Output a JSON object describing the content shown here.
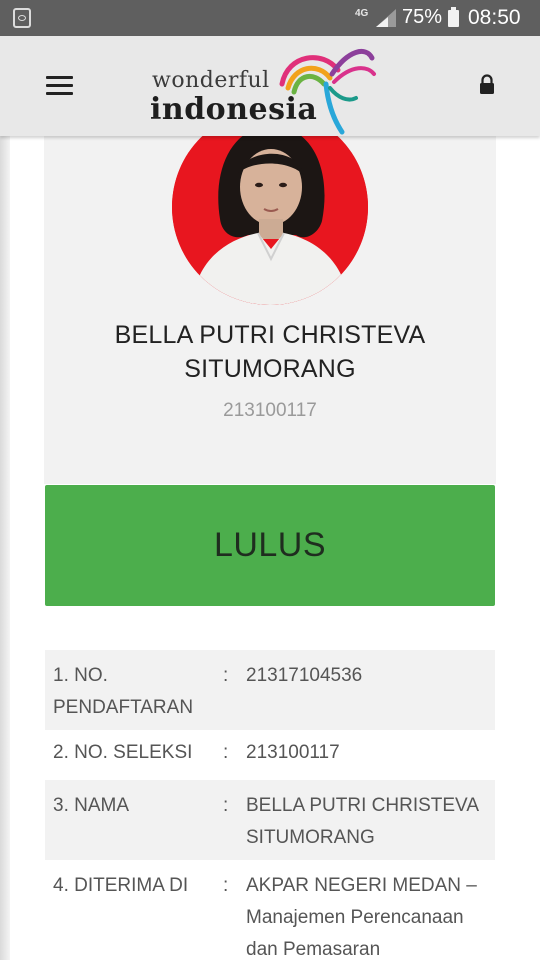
{
  "status_bar": {
    "network": "4G",
    "battery_percent": "75%",
    "time": "08:50",
    "icons": [
      "recycle-icon",
      "signal-icon",
      "battery-icon"
    ]
  },
  "header": {
    "logo_line1": "wonderful",
    "logo_line2": "indonesia",
    "icons": [
      "menu-icon",
      "lock-icon"
    ]
  },
  "profile": {
    "name": "BELLA PUTRI CHRISTEVA SITUMORANG",
    "id": "213100117",
    "avatar_background": "#e8161f"
  },
  "result": {
    "label": "LULUS",
    "color": "#4cae4c"
  },
  "details": {
    "rows": [
      {
        "label": "1. NO. PENDAFTARAN",
        "separator": ":",
        "value": "21317104536"
      },
      {
        "label": "2. NO. SELEKSI",
        "separator": ":",
        "value": "213100117"
      },
      {
        "label": "3. NAMA",
        "separator": ":",
        "value": "BELLA PUTRI CHRISTEVA SITUMORANG"
      },
      {
        "label": "4. DITERIMA DI",
        "separator": ":",
        "value": "AKPAR NEGERI MEDAN – Manajemen Perencanaan dan Pemasaran"
      }
    ]
  }
}
